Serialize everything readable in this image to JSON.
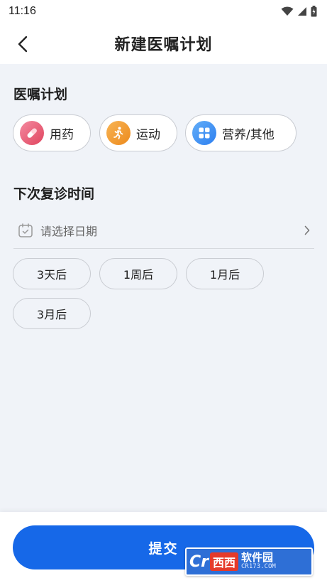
{
  "status_bar": {
    "time": "11:16"
  },
  "nav": {
    "title": "新建医嘱计划",
    "back_icon": "chevron-left-icon"
  },
  "plan_section": {
    "title": "医嘱计划",
    "items": [
      {
        "label": "用药",
        "icon": "pill-icon",
        "color": "#e8556c"
      },
      {
        "label": "运动",
        "icon": "running-icon",
        "color": "#f39a2b"
      },
      {
        "label": "营养/其他",
        "icon": "grid-icon",
        "color": "#3a8ff2"
      }
    ]
  },
  "followup_section": {
    "title": "下次复诊时间",
    "date_placeholder": "请选择日期",
    "quick_options": [
      "3天后",
      "1周后",
      "1月后",
      "3月后"
    ]
  },
  "submit": {
    "label": "提交",
    "color": "#1668e8"
  },
  "watermark": {
    "logo": "Cr",
    "brand": "西西",
    "title": "软件园",
    "subtitle": "CR173.COM"
  }
}
